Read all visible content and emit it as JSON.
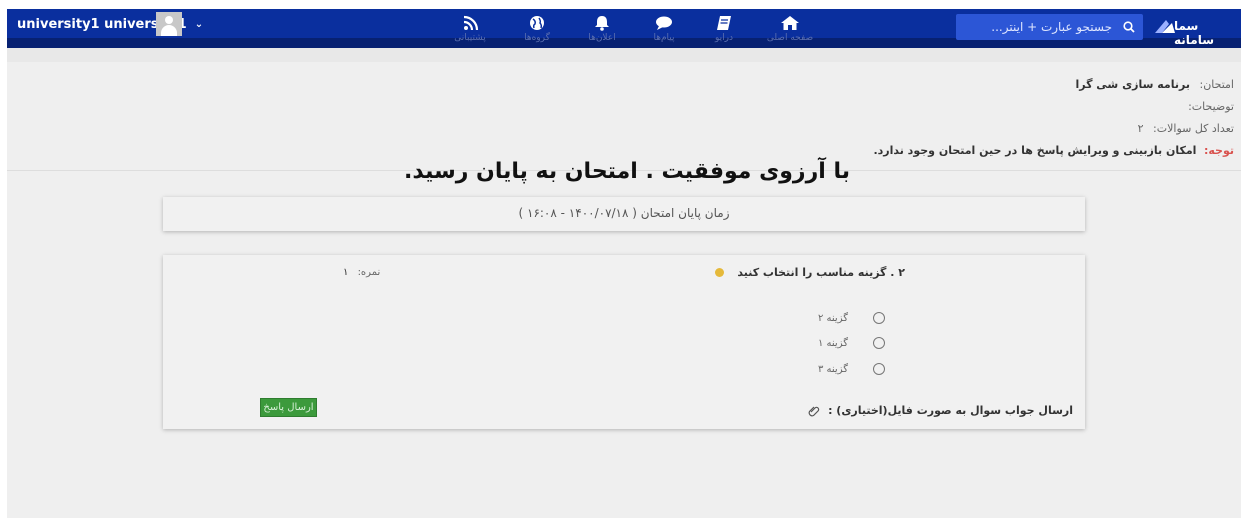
{
  "user": {
    "name": "university1 university1"
  },
  "nav": {
    "items": [
      {
        "label": "پشتیبانی",
        "icon": "rss-icon"
      },
      {
        "label": "گروه‌ها",
        "icon": "globe-icon"
      },
      {
        "label": "اعلان‌ها",
        "icon": "bell-icon"
      },
      {
        "label": "پیام‌ها",
        "icon": "chat-icon"
      },
      {
        "label": "درایو",
        "icon": "book-icon"
      },
      {
        "label": "صفحه اصلی",
        "icon": "home-icon"
      }
    ]
  },
  "search": {
    "placeholder": "جستجو عبارت + اینتر..."
  },
  "logo": {
    "text": "سما سامانه"
  },
  "exam": {
    "title_label": "امتحان:",
    "title_value": "برنامه سازی شی گرا",
    "desc_label": "توضیحات:",
    "count_label": "تعداد کل سوالات:",
    "count_value": "۲",
    "warning_label": "توجه:",
    "warning_value": "امکان بازبینی و ویرایش پاسخ ها در حین امتحان وجود ندارد."
  },
  "message": "با آرزوی موفقیت . امتحان به پایان رسید.",
  "end_time": "زمان پایان امتحان ( ۱۴۰۰/۰۷/۱۸ - ۱۶:۰۸ )",
  "question": {
    "text": "۲ . گزینه مناسب را انتخاب کنید",
    "score_label": "نمره:",
    "score_value": "۱",
    "options": [
      "گزینه ۲",
      "گزینه ۱",
      "گزینه ۳"
    ],
    "file_label": "ارسال جواب سوال به صورت فایل(اختیاری) :",
    "submit_label": "ارسال پاسخ"
  },
  "colors": {
    "topbar": "#0a2f9e",
    "search": "#2c56d6",
    "submit": "#3c9a3c",
    "warning": "#d9534f"
  }
}
